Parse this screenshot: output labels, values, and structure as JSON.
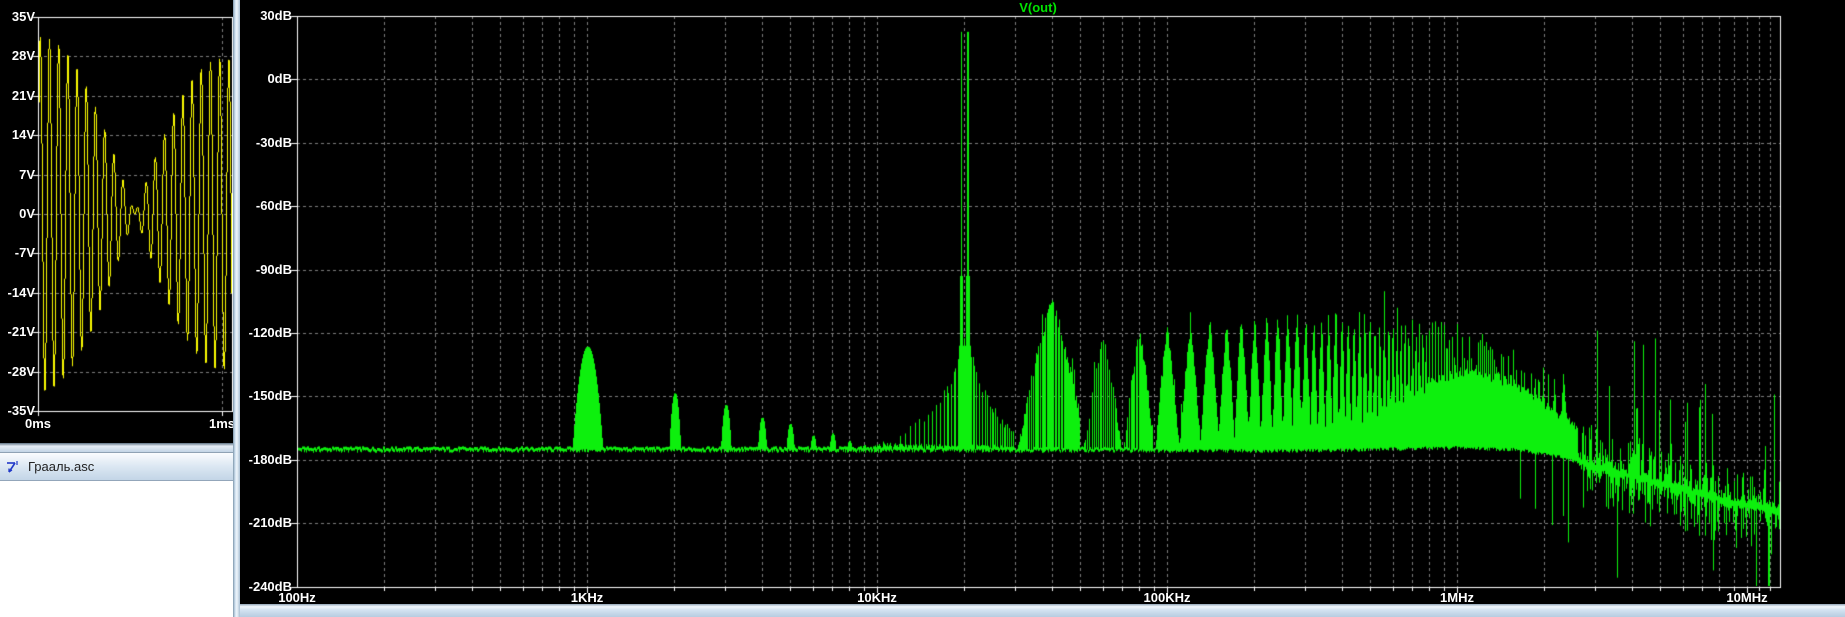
{
  "colors": {
    "trace_green": "#0df00d",
    "legend_green": "#00e400",
    "trace_yellow": "#fcfc00",
    "grid_gray": "#7d7d7d",
    "plot_bg": "#000000",
    "axis_white": "#ffffff",
    "chrome_blue": "#c8daea"
  },
  "fft_window": {
    "legend": "V(out)",
    "y_tick_labels": [
      "30dB",
      "0dB",
      "-30dB",
      "-60dB",
      "-90dB",
      "-120dB",
      "-150dB",
      "-180dB",
      "-210dB",
      "-240dB"
    ],
    "x_tick_labels": [
      "100Hz",
      "1KHz",
      "10KHz",
      "100KHz",
      "1MHz",
      "10MHz"
    ]
  },
  "scope_window": {
    "y_tick_labels": [
      "35V",
      "28V",
      "21V",
      "14V",
      "7V",
      "0V",
      "-7V",
      "-14V",
      "-21V",
      "-28V",
      "-35V"
    ],
    "x_tick_labels": [
      "0ms",
      "1ms"
    ]
  },
  "schematic_window": {
    "title": "Грааль.asc",
    "icon": "ltspice-schematic-icon"
  },
  "chart_data": [
    {
      "type": "line",
      "title": "time-domain waveform",
      "legend": "",
      "x_axis": {
        "ticks": [
          "0ms",
          "1ms"
        ],
        "range_ms": [
          0,
          1.06
        ],
        "grid": true
      },
      "y_axis": {
        "ticks": [
          "35V",
          "28V",
          "21V",
          "14V",
          "7V",
          "0V",
          "-7V",
          "-14V",
          "-21V",
          "-28V",
          "-35V"
        ],
        "range_v": [
          -35,
          35
        ],
        "grid": true
      },
      "synthesis": {
        "carrier_khz": 20,
        "envelope_hz": 500,
        "envelope_peak_v": 31,
        "carrier_leak_v": 3,
        "description": "double-sideband modulated sine: 20kHz carrier, 500Hz envelope, max ~34V, near-zero at 0.5ms"
      }
    },
    {
      "type": "line",
      "title": "FFT of V(out)",
      "legend": "V(out)",
      "x_axis": {
        "scale": "log",
        "ticks": [
          "100Hz",
          "1KHz",
          "10KHz",
          "100KHz",
          "1MHz",
          "10MHz"
        ],
        "range_hz": [
          100,
          13000000
        ],
        "grid": true
      },
      "y_axis": {
        "unit": "dB",
        "ticks_db": [
          30,
          0,
          -30,
          -60,
          -90,
          -120,
          -150,
          -180,
          -210,
          -240
        ],
        "ylim": [
          -240,
          30
        ],
        "grid": true
      },
      "noise_floor_db": -174.5,
      "peaks_db": {
        "fundamental": [
          [
            1000,
            -126.5
          ]
        ],
        "harmonics": [
          [
            2000,
            -148.5
          ],
          [
            3000,
            -154
          ],
          [
            4000,
            -160
          ],
          [
            5000,
            -163
          ],
          [
            6000,
            -168.5
          ],
          [
            7000,
            -167.5
          ],
          [
            8000,
            -171
          ],
          [
            9000,
            -173
          ]
        ],
        "carrier_twin_spikes": [
          [
            19500,
            22.5
          ],
          [
            20500,
            22.5
          ]
        ],
        "carrier_skirt": [
          [
            10000,
            -174
          ],
          [
            12000,
            -170
          ],
          [
            14000,
            -163
          ],
          [
            16000,
            -155
          ],
          [
            17500,
            -147
          ],
          [
            18600,
            -137
          ],
          [
            19300,
            -127
          ],
          [
            19500,
            -125
          ],
          [
            20000,
            -121
          ],
          [
            20500,
            -125
          ],
          [
            21000,
            -128
          ],
          [
            21800,
            -136
          ],
          [
            23000,
            -146
          ],
          [
            25000,
            -155
          ],
          [
            27000,
            -162
          ],
          [
            29500,
            -167
          ]
        ],
        "cluster_envelope": [
          [
            40000,
            -106
          ],
          [
            60000,
            -125
          ],
          [
            80000,
            -122
          ],
          [
            100000,
            -119.5
          ],
          [
            150000,
            -115
          ],
          [
            250000,
            -112.5
          ],
          [
            400000,
            -112
          ],
          [
            600000,
            -112
          ],
          [
            800000,
            -113.5
          ],
          [
            1000000,
            -117
          ],
          [
            1400000,
            -126
          ],
          [
            2000000,
            -138
          ],
          [
            2600000,
            -147
          ]
        ],
        "band_top": [
          [
            95000,
            -172
          ],
          [
            150000,
            -158
          ],
          [
            200000,
            -155
          ],
          [
            300000,
            -152
          ],
          [
            400000,
            -150
          ],
          [
            600000,
            -146
          ],
          [
            800000,
            -141
          ],
          [
            1000000,
            -137
          ],
          [
            1200000,
            -136
          ],
          [
            1600000,
            -142
          ],
          [
            2000000,
            -152
          ],
          [
            2600000,
            -163
          ]
        ],
        "valley_depth_db": [
          [
            95000,
            40
          ],
          [
            200000,
            28
          ],
          [
            300000,
            20
          ],
          [
            500000,
            12
          ],
          [
            700000,
            7
          ],
          [
            900000,
            4
          ],
          [
            2600000,
            3
          ]
        ],
        "floor_rolloff": [
          [
            100,
            -174.5
          ],
          [
            300000,
            -174.5
          ],
          [
            1000000,
            -173
          ],
          [
            1600000,
            -174
          ],
          [
            2200000,
            -177
          ],
          [
            3000000,
            -183
          ],
          [
            4500000,
            -189
          ],
          [
            6500000,
            -195
          ],
          [
            9000000,
            -200
          ],
          [
            13000000,
            -204
          ]
        ],
        "sideband_spacing_hz": 500,
        "cluster_spacing_hz": 20000
      }
    }
  ]
}
